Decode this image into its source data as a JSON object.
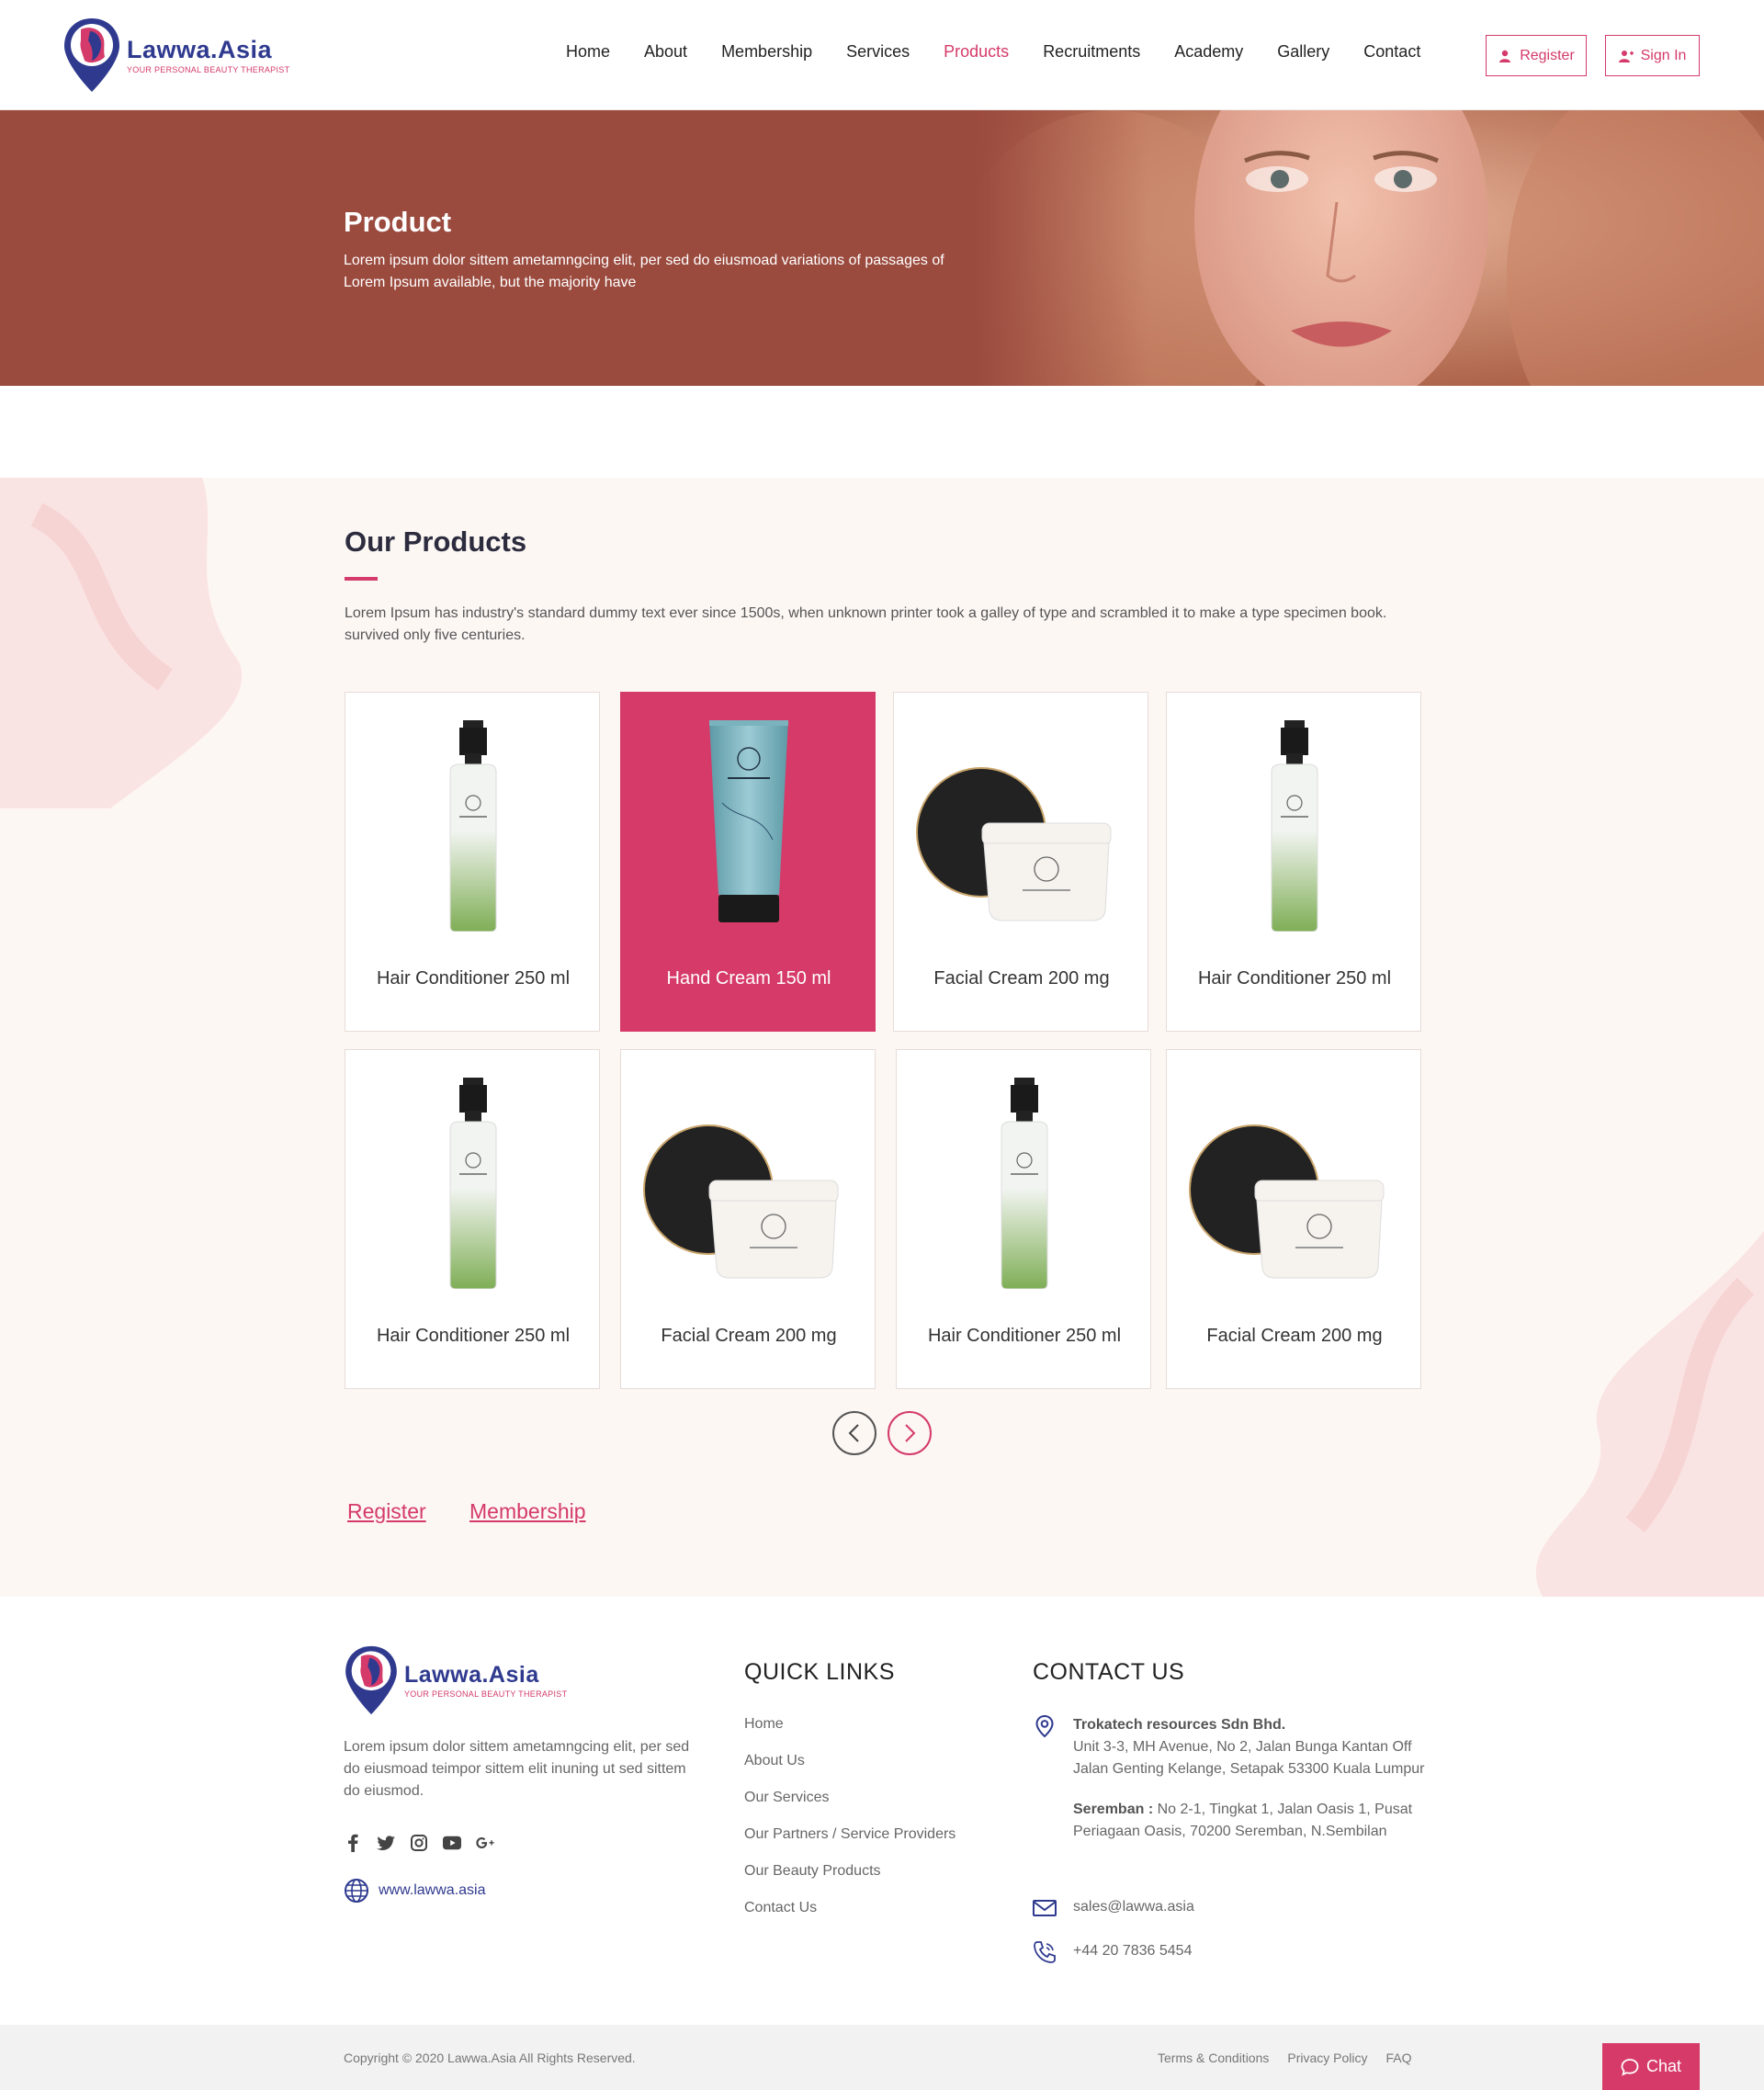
{
  "header": {
    "logo": {
      "name": "Lawwa.Asia",
      "tagline": "YOUR PERSONAL BEAUTY THERAPIST"
    },
    "nav": [
      "Home",
      "About",
      "Membership",
      "Services",
      "Products",
      "Recruitments",
      "Academy",
      "Gallery",
      "Contact"
    ],
    "active_nav": "Products",
    "register_label": "Register",
    "signin_label": "Sign In"
  },
  "hero": {
    "title": "Product",
    "description": "Lorem ipsum dolor sittem ametamngcing elit, per sed do eiusmoad variations of passages of Lorem Ipsum available, but the majority have"
  },
  "products": {
    "title": "Our Products",
    "description": "Lorem Ipsum has industry's standard dummy text ever since 1500s, when unknown printer took a galley of type and scrambled it to make a type specimen book. survived only five centuries.",
    "items": [
      {
        "name": "Hair Conditioner 250 ml",
        "image": "spray-bottle-icon"
      },
      {
        "name": "Hand Cream 150 ml",
        "image": "tube-icon",
        "active": true
      },
      {
        "name": "Facial Cream 200 mg",
        "image": "cream-jar-icon"
      },
      {
        "name": "Hair Conditioner 250 ml",
        "image": "spray-bottle-icon"
      },
      {
        "name": "Hair Conditioner 250 ml",
        "image": "spray-bottle-icon"
      },
      {
        "name": "Facial Cream 200 mg",
        "image": "cream-jar-icon"
      },
      {
        "name": "Hair Conditioner 250 ml",
        "image": "spray-bottle-icon"
      },
      {
        "name": "Facial Cream 200 mg",
        "image": "cream-jar-icon"
      }
    ],
    "links": {
      "register": "Register",
      "membership": "Membership"
    }
  },
  "footer": {
    "logo": {
      "name": "Lawwa.Asia",
      "tagline": "YOUR PERSONAL BEAUTY THERAPIST"
    },
    "description": "Lorem ipsum dolor sittem ametamngcing elit, per sed do eiusmoad teimpor sittem elit inuning ut sed sittem do eiusmod.",
    "social": [
      "facebook-icon",
      "twitter-icon",
      "instagram-icon",
      "youtube-icon",
      "google-plus-icon"
    ],
    "website": "www.lawwa.asia",
    "quick_links_title": "QUICK LINKS",
    "quick_links": [
      "Home",
      "About Us",
      "Our Services",
      "Our Partners / Service Providers",
      "Our Beauty Products",
      "Contact Us"
    ],
    "contact_title": "CONTACT US",
    "contact": {
      "company": "Trokatech resources Sdn Bhd.",
      "address1": "Unit 3-3, MH Avenue, No 2, Jalan Bunga Kantan Off Jalan Genting Kelange, Setapak 53300 Kuala Lumpur",
      "branch_label": "Seremban :",
      "address2": "No 2-1, Tingkat 1, Jalan Oasis 1, Pusat Periagaan Oasis, 70200 Seremban, N.Sembilan",
      "email": "sales@lawwa.asia",
      "phone": "+44 20 7836 5454"
    }
  },
  "bottombar": {
    "copyright": "Copyright © 2020 Lawwa.Asia All Rights Reserved.",
    "links": [
      "Terms & Conditions",
      "Privacy Policy",
      "FAQ"
    ],
    "chat_label": "Chat"
  },
  "colors": {
    "accent": "#d43a6a",
    "brand_blue": "#2f3a8f",
    "hero_bg": "#9b4a3e"
  }
}
